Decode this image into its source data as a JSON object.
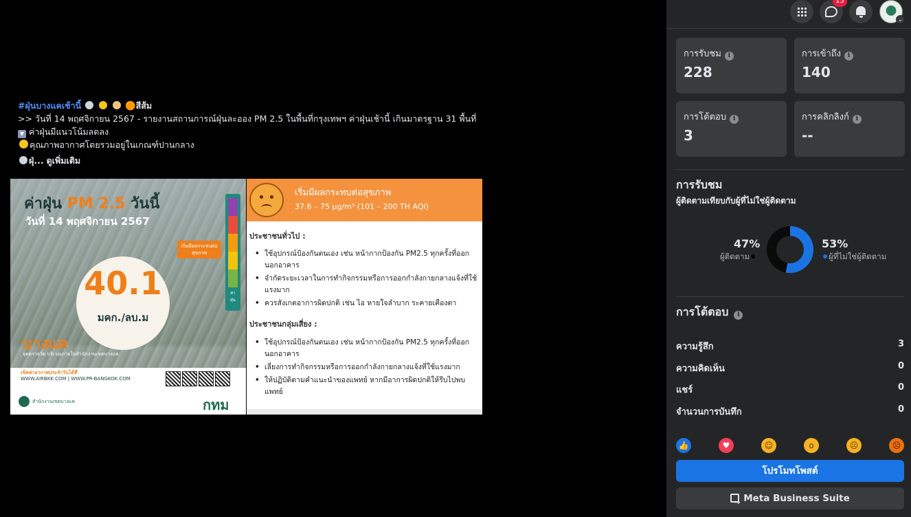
{
  "post": {
    "hashtag": "#ฝุ่นบางแคเช้านี้",
    "hashtag_trailing": "🟠สีส้ม",
    "line1": ">> วันที่ 14 พฤศจิกายน 2567 - รายงานสถานการณ์ฝุ่นละออง PM 2.5 ในพื้นที่กรุงเทพฯ ค่าฝุ่นเช้านี้ เกินมาตรฐาน 31 พื้นที่",
    "line2": "ค่าฝุ่นมีแนวโน้มลดลง",
    "line3": "คุณภาพอากาศโดยรวมอยู่ในเกณฑ์ปานกลาง",
    "line4_prefix": "ฝุ่...",
    "see_more": "ดูเพิ่มเติม"
  },
  "infographic_left": {
    "title_prefix": "ค่าฝุ่น ",
    "title_pm": "PM 2.5",
    "title_suffix": " วันนี้",
    "date": "วันที่ 14 พฤศจิกายน 2567",
    "value": "40.1",
    "unit": "มคก./ลบ.ม",
    "level_tag": "เริ่มมีผลกระทบต่อสุขภาพ",
    "scale_label": "ค่าฝุ่น",
    "place": "บางแค",
    "place_sub": "จุดตรวจวัด บริเวณภายในสำนักงานเขตบางแค",
    "check_text": "เช็คค่าอากาศประจำวันได้ที่",
    "sites": "WWW.AIRBKK.COM | WWW.PR-BANGKOK.COM",
    "office": "สำนักงานเขตบางแค",
    "bkk": "กทม"
  },
  "infographic_right": {
    "heading": "เริ่มมีผลกระทบต่อสุขภาพ",
    "range": "37.6 – 75 µg/m³ (101 – 200 TH AQI)",
    "general_title": "ประชาชนทั่วไป :",
    "general_items": [
      "ใช้อุปกรณ์ป้องกันตนเอง เช่น หน้ากากป้องกัน PM2.5 ทุกครั้งที่ออกนอกอาคาร",
      "จำกัดระยะเวลาในการทำกิจกรรมหรือการออกกำลังกายกลางแจ้งที่ใช้แรงมาก",
      "ควรสังเกตอาการผิดปกติ เช่น ไอ หายใจลำบาก ระคายเคืองตา"
    ],
    "risk_title": "ประชาชนกลุ่มเสี่ยง :",
    "risk_items": [
      "ใช้อุปกรณ์ป้องกันตนเอง เช่น หน้ากากป้องกัน PM2.5 ทุกครั้งที่ออกนอกอาคาร",
      "เลี่ยงการทำกิจกรรมหรือการออกกำลังกายกลางแจ้งที่ใช้แรงมาก",
      "ให้ปฏิบัติตามคำแนะนำของแพทย์ หากมีอาการผิดปกติให้รีบไปพบแพทย์"
    ]
  },
  "topbar": {
    "messenger_badge": "15"
  },
  "stats": {
    "views_label": "การรับชม",
    "views_value": "228",
    "reach_label": "การเข้าถึง",
    "reach_value": "140",
    "interactions_label": "การโต้ตอบ",
    "interactions_value": "3",
    "link_clicks_label": "การคลิกลิงก์",
    "link_clicks_value": "--"
  },
  "views_section": {
    "title": "การรับชม",
    "subtitle": "ผู้ติดตามเทียบกับผู้ที่ไม่ใช่ผู้ติดตาม",
    "followers_pct": "47%",
    "followers_label": "ผู้ติดตาม",
    "non_followers_pct": "53%",
    "non_followers_label": "ผู้ที่ไม่ใช่ผู้ติดตาม",
    "followers_color": "#0a0a0a",
    "non_followers_color": "#1b74e4"
  },
  "interactions_section": {
    "title": "การโต้ตอบ",
    "rows": [
      {
        "label": "ความรู้สึก",
        "value": "3"
      },
      {
        "label": "ความคิดเห็น",
        "value": "0"
      },
      {
        "label": "แชร์",
        "value": "0"
      },
      {
        "label": "จำนวนการบันทึก",
        "value": "0"
      }
    ]
  },
  "reactions": [
    "like-icon",
    "love-icon",
    "haha-icon",
    "wow-icon",
    "sad-icon",
    "angry-icon"
  ],
  "buttons": {
    "promote": "โปรโมทโพสต์",
    "meta_business": "Meta Business Suite"
  }
}
